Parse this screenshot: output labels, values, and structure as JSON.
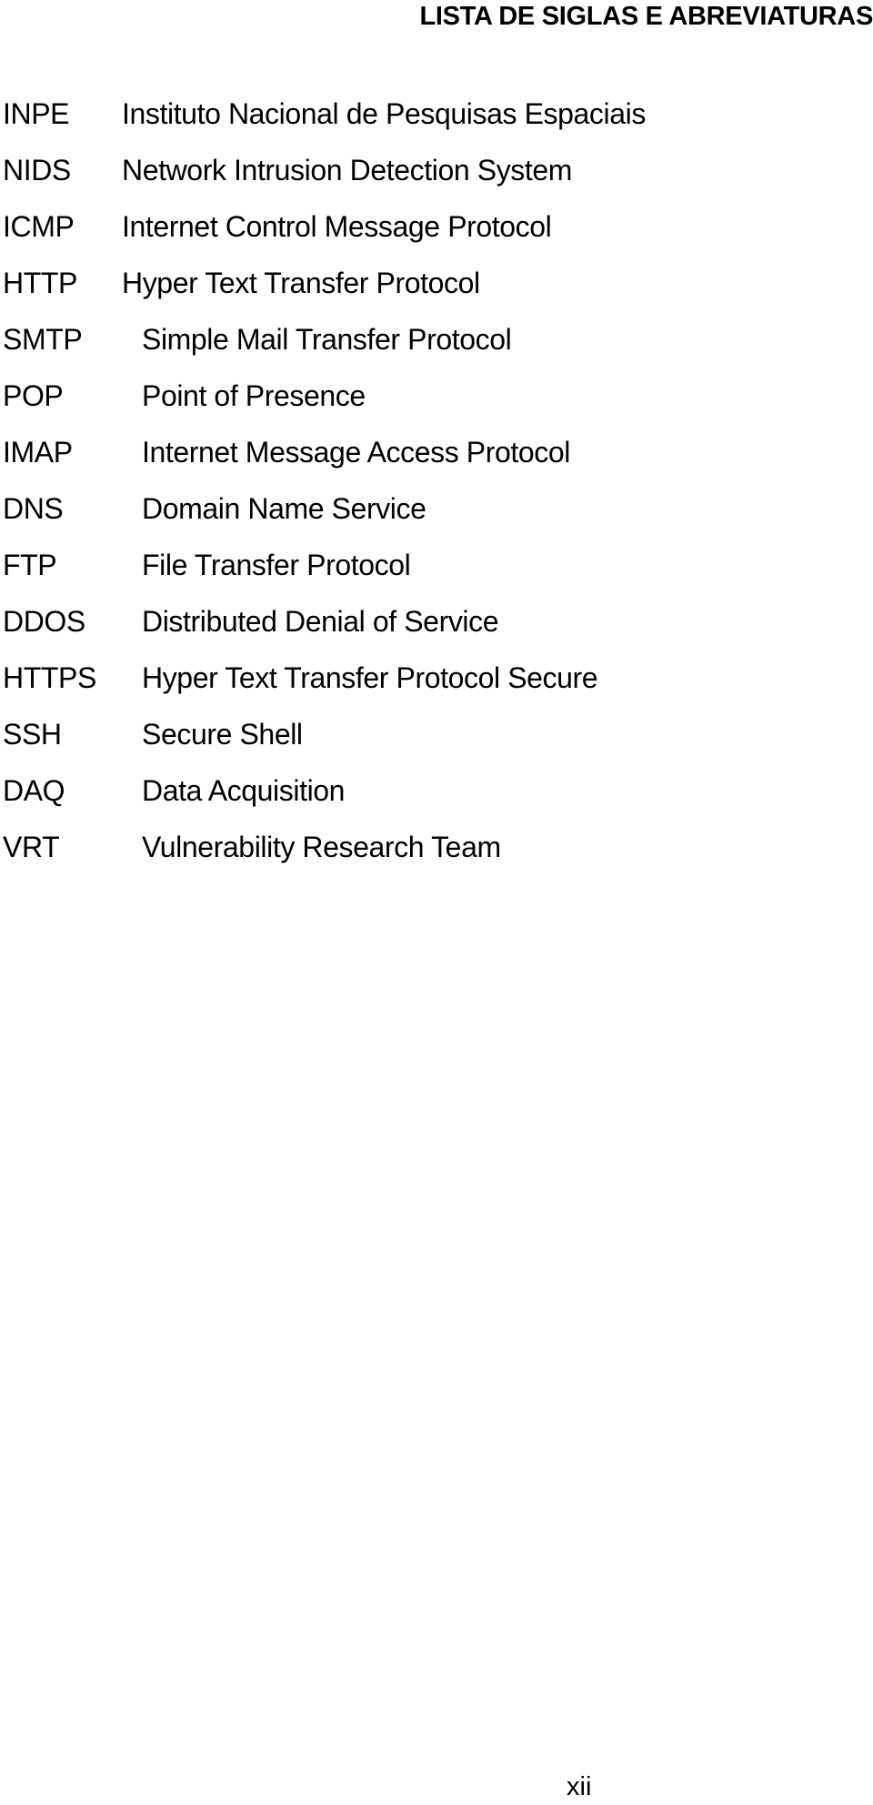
{
  "title": "LISTA DE SIGLAS E ABREVIATURAS",
  "entries": [
    {
      "abbr": "INPE",
      "definition": "Instituto Nacional de Pesquisas Espaciais"
    },
    {
      "abbr": "NIDS",
      "definition": "Network Intrusion Detection System"
    },
    {
      "abbr": "ICMP",
      "definition": "Internet Control Message Protocol"
    },
    {
      "abbr": "HTTP",
      "definition": "Hyper Text Transfer Protocol"
    },
    {
      "abbr": "SMTP",
      "definition": "Simple Mail Transfer Protocol"
    },
    {
      "abbr": "POP",
      "definition": "Point of Presence"
    },
    {
      "abbr": "IMAP",
      "definition": "Internet Message Access Protocol"
    },
    {
      "abbr": "DNS",
      "definition": "Domain Name Service"
    },
    {
      "abbr": "FTP",
      "definition": "File Transfer Protocol"
    },
    {
      "abbr": "DDOS",
      "definition": "Distributed Denial of Service"
    },
    {
      "abbr": "HTTPS",
      "definition": "Hyper Text Transfer Protocol Secure"
    },
    {
      "abbr": "SSH",
      "definition": "Secure Shell"
    },
    {
      "abbr": "DAQ",
      "definition": "Data Acquisition"
    },
    {
      "abbr": "VRT",
      "definition": "Vulnerability Research Team"
    }
  ],
  "page_number": "xii"
}
